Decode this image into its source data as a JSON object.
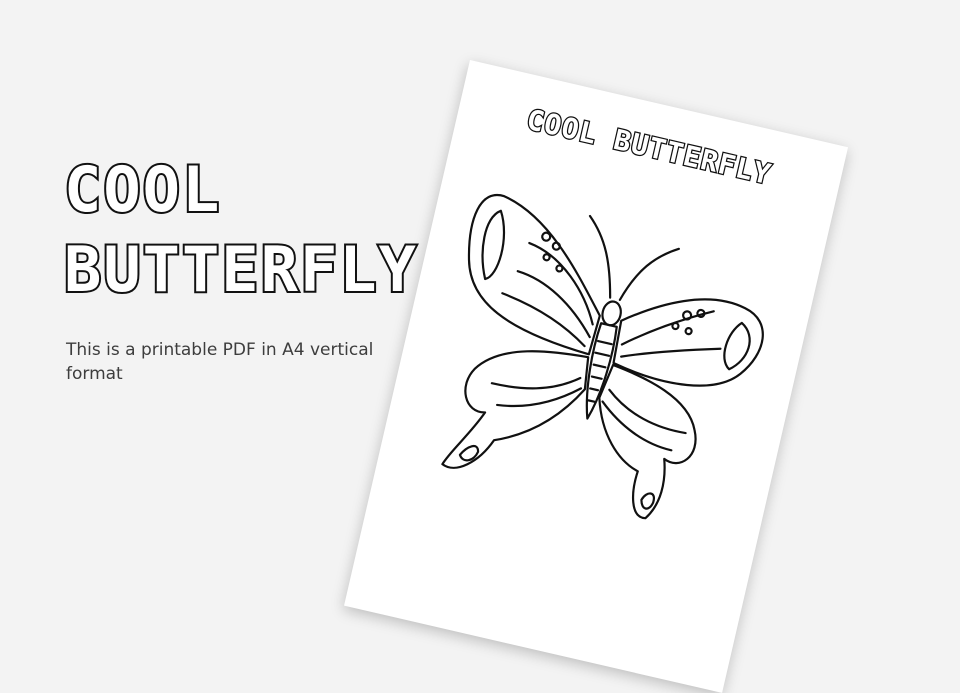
{
  "hero": {
    "title_line1": "COOL",
    "title_line2": "BUTTERFLY",
    "subtitle": "This is a printable PDF in A4 vertical format"
  },
  "sheet": {
    "title": "COOL BUTTERFLY",
    "illustration": "butterfly-coloring-illustration"
  },
  "colors": {
    "background": "#f3f3f3",
    "outline": "#111111",
    "paper": "#ffffff",
    "text": "#3d3d3d"
  }
}
